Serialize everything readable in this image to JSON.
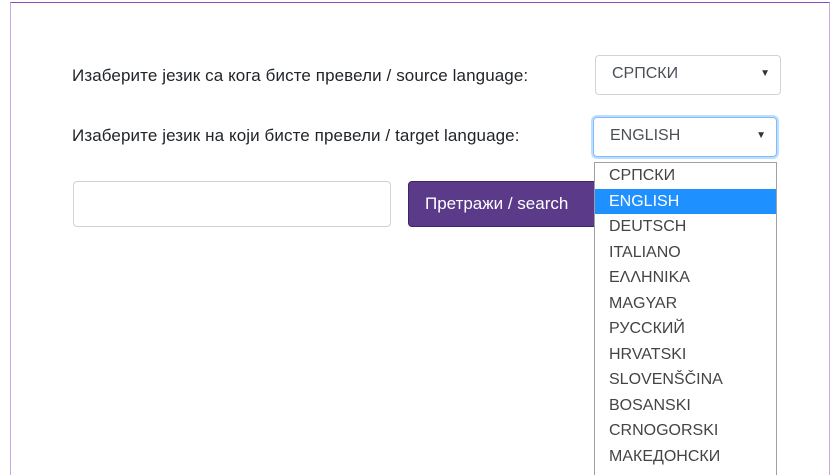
{
  "form": {
    "source_label": "Изаберите језик са кога бисте превели / source language:",
    "target_label": "Изаберите језик на који бисте превели / target language:",
    "source_value": "СРПСКИ",
    "target_value": "ENGLISH",
    "search_placeholder": "",
    "search_button": "Претражи / search"
  },
  "dropdown": {
    "options": [
      "СРПСКИ",
      "ENGLISH",
      "DEUTSCH",
      "ITALIANO",
      "ΕΛΛΗΝΙΚΑ",
      "MAGYAR",
      "РУССКИЙ",
      "HRVATSKI",
      "SLOVENŠČINA",
      "BOSANSKI",
      "CRNOGORSKI",
      "МАКЕДОНСКИ"
    ],
    "selected_index": 1
  },
  "colors": {
    "button_bg": "#5b3a8a",
    "selected_option_bg": "#1e90ff",
    "focus_border": "#80bdff",
    "frame_border": "#8e4bbf"
  },
  "icons": {
    "select_arrow": "chevron-down-icon"
  }
}
